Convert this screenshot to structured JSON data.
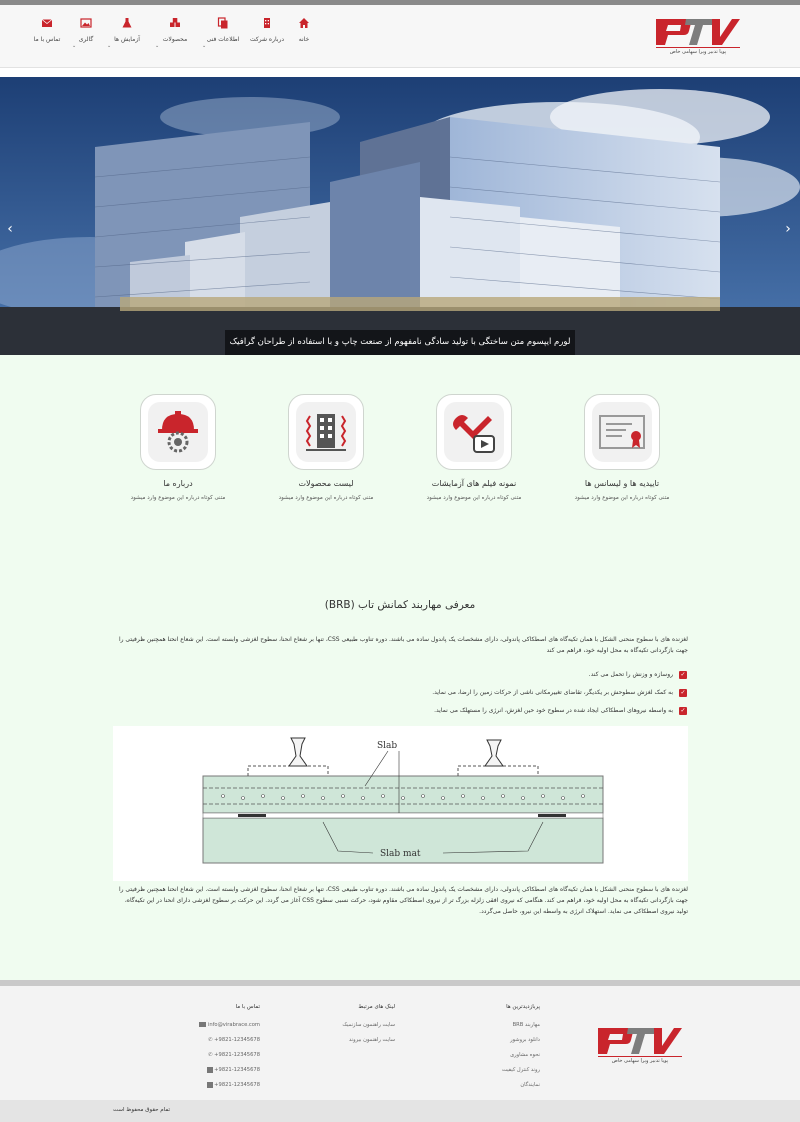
{
  "brand": {
    "logo_text": "PTV",
    "tagline": "پویا تدبیر ویرا سهامی خاص"
  },
  "nav": [
    {
      "label": "خانه",
      "icon": "home-icon"
    },
    {
      "label": "درباره شرکت",
      "icon": "building-icon"
    },
    {
      "label": "اطلاعات فنی",
      "icon": "copy-icon"
    },
    {
      "label": "محصولات",
      "icon": "cubes-icon"
    },
    {
      "label": "آزمایش ها",
      "icon": "flask-icon"
    },
    {
      "label": "گالری",
      "icon": "image-icon"
    },
    {
      "label": "تماس با ما",
      "icon": "envelope-icon"
    }
  ],
  "hero": {
    "caption": "لورم ایپسوم متن ساختگی با تولید سادگی نامفهوم از صنعت چاپ و با استفاده از طراحان گرافیک است"
  },
  "features": [
    {
      "title": "تاییدیه ها و لیسانس ها",
      "desc": "متنی کوتاه درباره این موضوع وارد میشود",
      "icon": "certificate-icon"
    },
    {
      "title": "نمونه فیلم های آزمایشات",
      "desc": "متنی کوتاه درباره این موضوع وارد میشود",
      "icon": "tools-video-icon"
    },
    {
      "title": "لیست محصولات",
      "desc": "متنی کوتاه درباره این موضوع وارد میشود",
      "icon": "building-shock-icon"
    },
    {
      "title": "درباره ما",
      "desc": "متنی کوتاه درباره این موضوع وارد میشود",
      "icon": "helmet-gear-icon"
    }
  ],
  "section": {
    "title": "معرفی مهاربند کمانش تاب (BRB)",
    "intro": "لغزنده های با سطوح منحنی الشکل با همان تکیه‌گاه های اصطکاکی پاندولی، دارای مشخصات یک پاندول ساده می باشند. دوره تناوب طبیعی CSS، تنها بر شعاع انحنا، سطوح لغزشی وابسته است. این شعاع انحنا همچنین ظرفیتی را جهت بازگردانی تکیه‌گاه به محل اولیه خود، فراهم می کند",
    "bullets": [
      "روسازه و وزنش را تحمل می کند.",
      "به کمک لغزش سطوحش بر یکدیگر، تقاضای تغییرمکانی ناشی از حرکات زمین را ارضا، می نماید.",
      "به واسطه نیروهای اصطکاکی ایجاد شده در سطوح خود حین لغزش، انرژی را مستهلک می نماید."
    ],
    "diagram_labels": {
      "slab": "Slab",
      "slab_mat": "Slab mat"
    },
    "outro": "لغزنده های با سطوح منحنی الشکل با همان تکیه‌گاه های اصطکاکی پاندولی، دارای مشخصات یک پاندول ساده می باشند. دوره تناوب طبیعی CSS، تنها بر شعاع انحنا، سطوح لغزشی وابسته است. این شعاع انحنا همچنین ظرفیتی را جهت بازگردانی تکیه‌گاه به محل اولیه خود، فراهم می کند. هنگامی که نیروی افقی زلزله بزرگ تر از نیروی اصطکاکی مقاوم شود، حرکت نسبی سطوح CSS آغاز می گردد. این حرکت بر سطوح لغزشی دارای انحنا در این تکیه‌گاه، تولید نیروی اصطکاکی می نماید. استهلاک انرژی به واسطه این نیرو، حاصل می‌گردد."
  },
  "footer": {
    "col1": {
      "heading": "پربازدیدترین ها",
      "items": [
        "مهاربند BRB",
        "دانلود بروشور",
        "نحوه مشاوری",
        "روند کنترل کیفیت",
        "نمایندگان"
      ]
    },
    "col2": {
      "heading": "لینک های مرتبط",
      "items": [
        "سایت راهنمون سازنمیک",
        "سایت راهنمون بیروند"
      ]
    },
    "col3": {
      "heading": "تماس با ما",
      "items": [
        "info@virabrace.com",
        "+9821-12345678",
        "+9821-12345678",
        "+9821-12345678",
        "+9821-12345678"
      ]
    },
    "copyright": "تمام حقوق محفوظ است"
  },
  "colors": {
    "accent": "#c9252c",
    "logo_gray": "#7d7d7d",
    "main_bg": "#f0fcf0"
  }
}
